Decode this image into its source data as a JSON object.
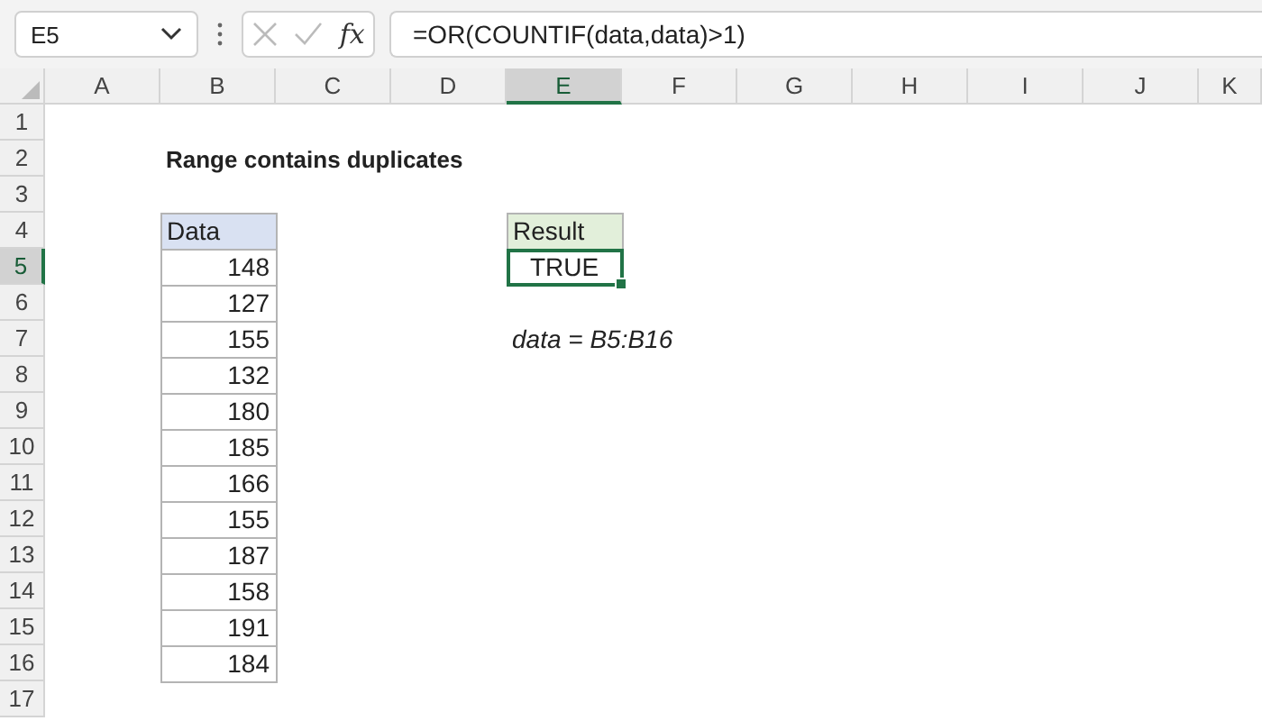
{
  "formula_bar": {
    "name_box": "E5",
    "function_label": "fx",
    "formula": "=OR(COUNTIF(data,data)>1)"
  },
  "columns": [
    {
      "label": "A",
      "selected": false
    },
    {
      "label": "B",
      "selected": false
    },
    {
      "label": "C",
      "selected": false
    },
    {
      "label": "D",
      "selected": false
    },
    {
      "label": "E",
      "selected": true
    },
    {
      "label": "F",
      "selected": false
    },
    {
      "label": "G",
      "selected": false
    },
    {
      "label": "H",
      "selected": false
    },
    {
      "label": "I",
      "selected": false
    },
    {
      "label": "J",
      "selected": false
    },
    {
      "label": "K",
      "selected": false
    }
  ],
  "rows": [
    {
      "label": "1",
      "selected": false
    },
    {
      "label": "2",
      "selected": false
    },
    {
      "label": "3",
      "selected": false
    },
    {
      "label": "4",
      "selected": false
    },
    {
      "label": "5",
      "selected": true
    },
    {
      "label": "6",
      "selected": false
    },
    {
      "label": "7",
      "selected": false
    },
    {
      "label": "8",
      "selected": false
    },
    {
      "label": "9",
      "selected": false
    },
    {
      "label": "10",
      "selected": false
    },
    {
      "label": "11",
      "selected": false
    },
    {
      "label": "12",
      "selected": false
    },
    {
      "label": "13",
      "selected": false
    },
    {
      "label": "14",
      "selected": false
    },
    {
      "label": "15",
      "selected": false
    },
    {
      "label": "16",
      "selected": false
    },
    {
      "label": "17",
      "selected": false
    }
  ],
  "title": "Range contains duplicates",
  "data_table": {
    "header": "Data",
    "values": [
      "148",
      "127",
      "155",
      "132",
      "180",
      "185",
      "166",
      "155",
      "187",
      "158",
      "191",
      "184"
    ]
  },
  "result_table": {
    "header": "Result",
    "value": "TRUE",
    "selected": true
  },
  "note": "data = B5:B16"
}
